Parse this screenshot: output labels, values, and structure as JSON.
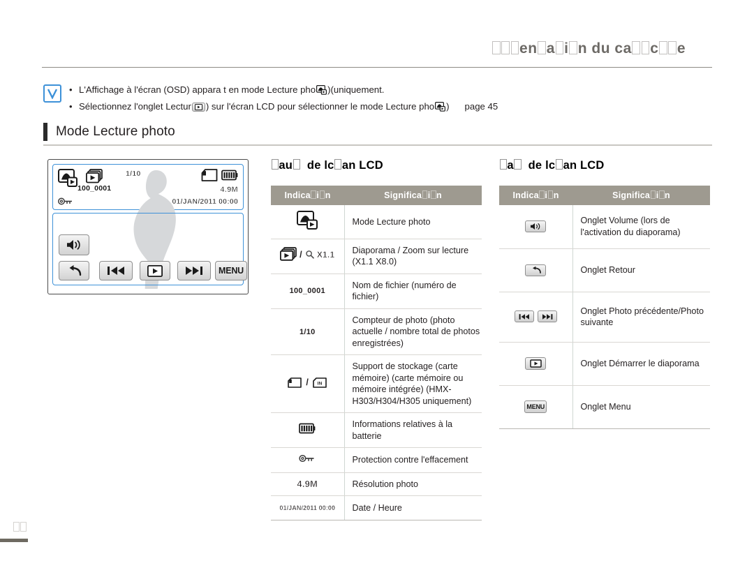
{
  "header": {
    "running_title": "Présentation du caméscope",
    "running_title_rendered": "□□□en□a□i□n du ca□□c□□e"
  },
  "note": {
    "icon": "check-v-icon",
    "bullets": [
      "L'Affichage à l'écran (OSD) apparaît en mode Lecture photo ( ) uniquement.",
      "Sélectionnez l'onglet Lecture ( ) sur l'écran LCD pour sélectionner le mode Lecture photo ( ). page 45"
    ],
    "bullet1_pre": "L'Affichage à l'écran (OSD) appara t en mode Lecture pho",
    "bullet1_post": ")(uniquement.",
    "bullet2_pre": "Sélectionnez l'onglet Lectur",
    "bullet2_mid": ") sur l'écran LCD pour sélectionner le mode Lecture pho",
    "bullet2_post": ")",
    "page_ref": "page 45"
  },
  "section": {
    "title": "Mode Lecture photo"
  },
  "lcd": {
    "mode_icon": "photo-playback-mode-icon",
    "slideshow_icon": "slideshow-icon",
    "counter": "1/10",
    "file_name": "100_0001",
    "key_icon": "erase-protection-key-icon",
    "card_icon": "memory-card-icon",
    "battery_icon": "battery-icon",
    "resolution": "4.9M",
    "datetime": "01/JAN/2011 00:00",
    "tabs": {
      "volume": "volume-tab-icon",
      "back": "back-tab-icon",
      "prev": "previous-photo-tab-icon",
      "play": "start-slideshow-tab-icon",
      "next": "next-photo-tab-icon",
      "menu": "MENU"
    }
  },
  "table_left": {
    "title": "Haut de l'écran LCD",
    "title_rendered": "□au□ de lc□an LCD",
    "columns": [
      "Indication",
      "Signification"
    ],
    "columns_rendered": [
      "Indica□i□n",
      "Significa□i□n"
    ],
    "rows": [
      {
        "indicator_type": "icon",
        "indicator": "photo-playback-mode-icon",
        "meaning": "Mode Lecture photo"
      },
      {
        "indicator_type": "icon",
        "indicator": "slideshow-and-playback-zoom-icon",
        "meaning": "Diaporama / Zoom sur lecture (X1.1 X8.0)"
      },
      {
        "indicator_type": "text",
        "indicator": "100_0001",
        "meaning": "Nom de fichier (numéro de fichier)"
      },
      {
        "indicator_type": "text",
        "indicator": "1/10",
        "meaning": "Compteur de photo (photo actuelle / nombre total de photos enregistrées)"
      },
      {
        "indicator_type": "icon",
        "indicator": "memory-card-and-internal-memory-icon",
        "meaning": "Support de stockage (carte mémoire) (carte mémoire ou mémoire intégrée) (HMX-H303/H304/H305 uniquement)"
      },
      {
        "indicator_type": "icon",
        "indicator": "battery-icon",
        "meaning": "Informations relatives à la batterie"
      },
      {
        "indicator_type": "icon",
        "indicator": "erase-protection-key-icon",
        "meaning": "Protection contre l'effacement"
      },
      {
        "indicator_type": "text",
        "indicator": "4.9M",
        "meaning": "Résolution photo"
      },
      {
        "indicator_type": "text",
        "indicator": "01/JAN/2011 00:00",
        "meaning": "Date / Heure"
      }
    ]
  },
  "table_right": {
    "title": "Bas de l'écran LCD",
    "title_rendered": "□a□ de lc□an LCD",
    "columns": [
      "Indication",
      "Signification"
    ],
    "columns_rendered": [
      "Indica□i□n",
      "Significa□i□n"
    ],
    "rows": [
      {
        "indicator_type": "icon",
        "indicator": "volume-tab-icon",
        "meaning": "Onglet Volume (lors de l'activation du diaporama)"
      },
      {
        "indicator_type": "icon",
        "indicator": "back-tab-icon",
        "meaning": "Onglet Retour"
      },
      {
        "indicator_type": "icon",
        "indicator": "prev-next-photo-tab-icon",
        "meaning": "Onglet Photo précédente/Photo suivante"
      },
      {
        "indicator_type": "icon",
        "indicator": "start-slideshow-tab-icon",
        "meaning": "Onglet Démarrer le diaporama"
      },
      {
        "indicator_type": "icon",
        "indicator": "menu-tab-icon",
        "meaning": "Onglet Menu"
      }
    ]
  },
  "footer": {
    "page_number": "□□"
  },
  "colors": {
    "accent_blue": "#3d91d8",
    "table_header": "#9e9a90",
    "header_text": "#6d6a66",
    "body_text": "#231f20"
  }
}
